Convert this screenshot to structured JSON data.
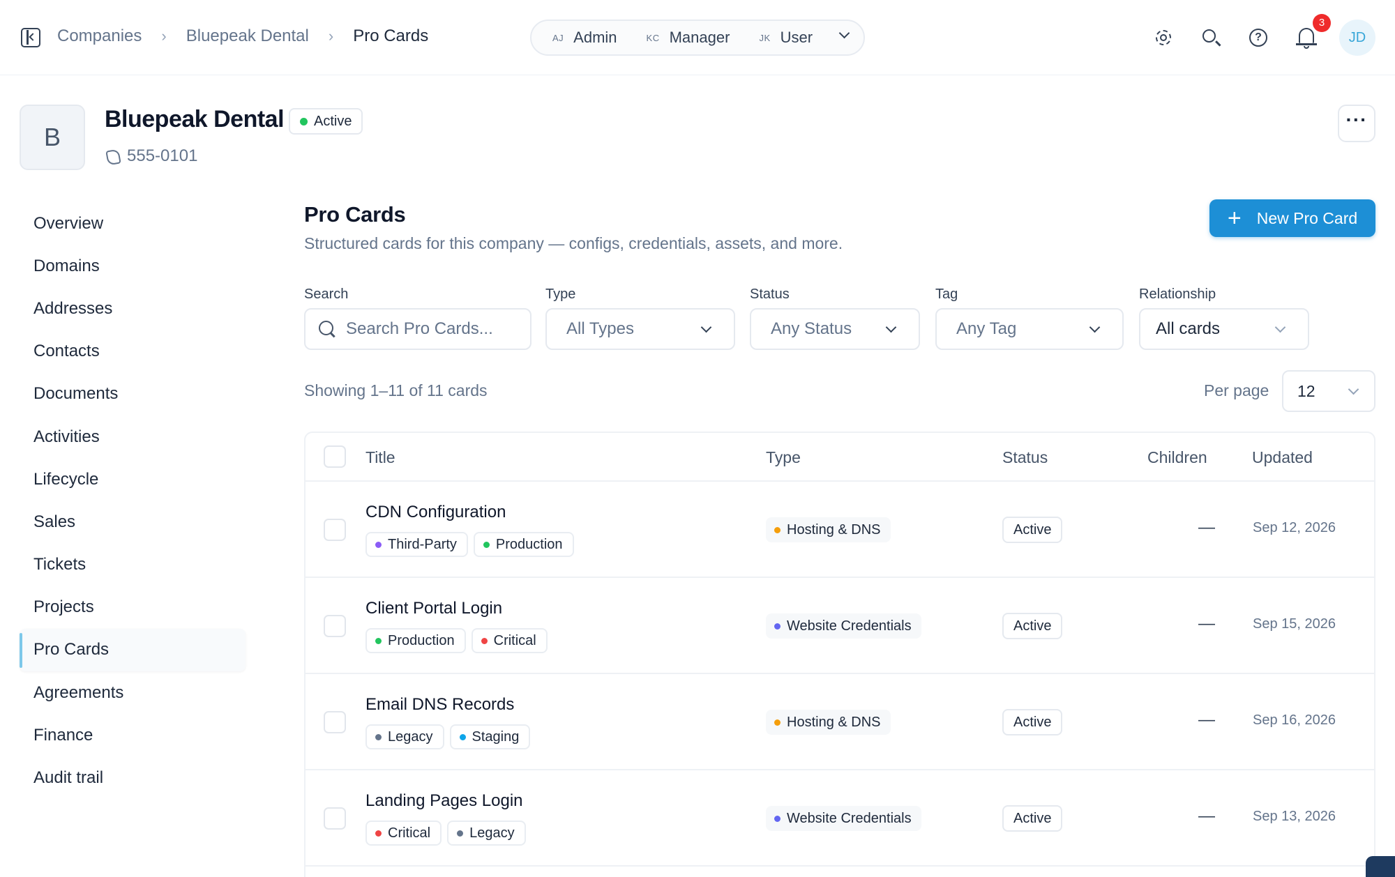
{
  "breadcrumb": [
    "Companies",
    "Bluepeak Dental",
    "Pro Cards"
  ],
  "roles": [
    {
      "initials": "AJ",
      "label": "Admin"
    },
    {
      "initials": "KC",
      "label": "Manager"
    },
    {
      "initials": "JK",
      "label": "User"
    }
  ],
  "notifications": {
    "count": "3"
  },
  "user": {
    "initials": "JD"
  },
  "company": {
    "logo_letter": "B",
    "name": "Bluepeak Dental",
    "status": "Active",
    "status_color": "#22c55e",
    "phone": "555-0101"
  },
  "nav": [
    {
      "label": "Overview"
    },
    {
      "label": "Domains"
    },
    {
      "label": "Addresses"
    },
    {
      "label": "Contacts"
    },
    {
      "label": "Documents"
    },
    {
      "label": "Activities"
    },
    {
      "label": "Lifecycle"
    },
    {
      "label": "Sales"
    },
    {
      "label": "Tickets"
    },
    {
      "label": "Projects"
    },
    {
      "label": "Pro Cards",
      "active": true
    },
    {
      "label": "Agreements"
    },
    {
      "label": "Finance"
    },
    {
      "label": "Audit trail"
    }
  ],
  "main": {
    "title": "Pro Cards",
    "subtitle": "Structured cards for this company — configs, credentials, assets, and more.",
    "new_button": "New Pro Card",
    "accent": "#1d8fd6"
  },
  "filters": {
    "search": {
      "label": "Search",
      "placeholder": "Search Pro Cards..."
    },
    "type": {
      "label": "Type",
      "value": "All Types"
    },
    "status": {
      "label": "Status",
      "value": "Any Status"
    },
    "tag": {
      "label": "Tag",
      "value": "Any Tag"
    },
    "relationship": {
      "label": "Relationship",
      "value": "All cards"
    }
  },
  "results": {
    "showing": "Showing 1–11 of 11 cards",
    "per_page_label": "Per page",
    "per_page_value": "12"
  },
  "table": {
    "columns": [
      "Title",
      "Type",
      "Status",
      "Children",
      "Updated"
    ],
    "rows": [
      {
        "title": "CDN Configuration",
        "tags": [
          {
            "label": "Third-Party",
            "color": "#8b5cf6"
          },
          {
            "label": "Production",
            "color": "#22c55e"
          }
        ],
        "type": {
          "label": "Hosting & DNS",
          "color": "#f59e0b"
        },
        "status": "Active",
        "children": "—",
        "updated": "Sep 12, 2026"
      },
      {
        "title": "Client Portal Login",
        "tags": [
          {
            "label": "Production",
            "color": "#22c55e"
          },
          {
            "label": "Critical",
            "color": "#ef4444"
          }
        ],
        "type": {
          "label": "Website Credentials",
          "color": "#6366f1"
        },
        "status": "Active",
        "children": "—",
        "updated": "Sep 15, 2026"
      },
      {
        "title": "Email DNS Records",
        "tags": [
          {
            "label": "Legacy",
            "color": "#64748b"
          },
          {
            "label": "Staging",
            "color": "#0ea5e9"
          }
        ],
        "type": {
          "label": "Hosting & DNS",
          "color": "#f59e0b"
        },
        "status": "Active",
        "children": "—",
        "updated": "Sep 16, 2026"
      },
      {
        "title": "Landing Pages Login",
        "tags": [
          {
            "label": "Critical",
            "color": "#ef4444"
          },
          {
            "label": "Legacy",
            "color": "#64748b"
          }
        ],
        "type": {
          "label": "Website Credentials",
          "color": "#6366f1"
        },
        "status": "Active",
        "children": "—",
        "updated": "Sep 13, 2026"
      }
    ]
  }
}
